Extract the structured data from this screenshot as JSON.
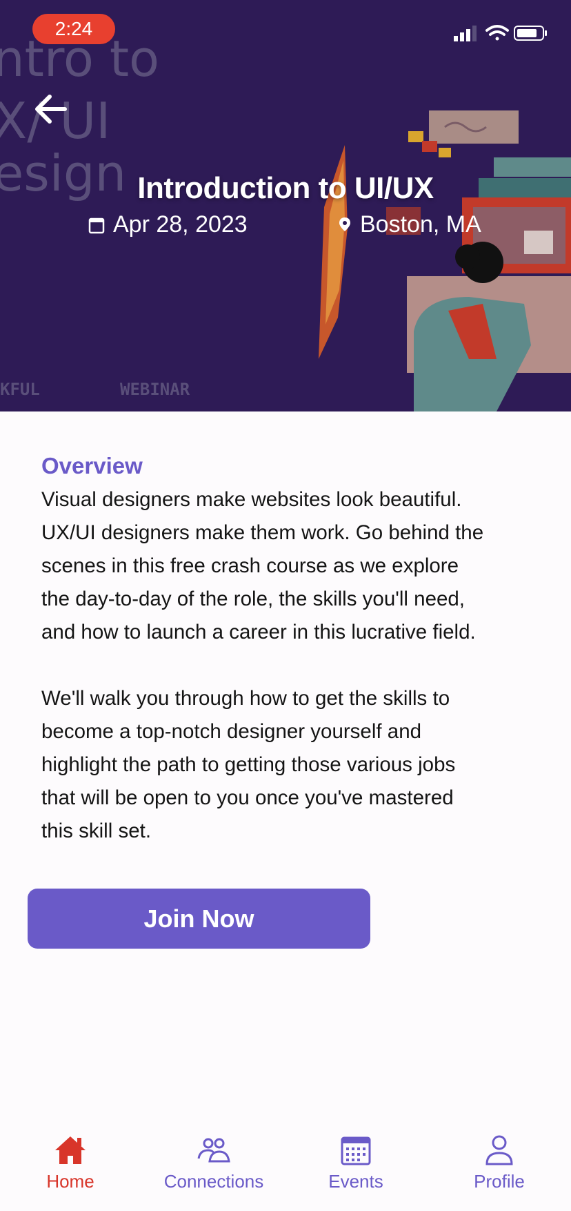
{
  "status_bar": {
    "time": "2:24"
  },
  "event": {
    "title": "Introduction to UI/UX",
    "date": "Apr 28, 2023",
    "location": "Boston, MA",
    "banner_text": {
      "line1": "ntro to",
      "line2": "X/ UI",
      "line3": "esign",
      "tag_left": "KFUL",
      "tag_right": "WEBINAR"
    }
  },
  "overview": {
    "heading": "Overview",
    "paragraph1": "Visual designers make websites look beautiful.\nUX/UI designers make them work. Go behind the\nscenes in this free crash course as we explore\nthe day-to-day of the role, the skills you'll need,\nand how to launch a career in this lucrative field.",
    "paragraph2": "We'll walk you through how to get the skills to\nbecome a top-notch designer yourself and\nhighlight the path to getting those various jobs\nthat will be open to you once you've mastered\nthis skill set."
  },
  "actions": {
    "join_label": "Join Now"
  },
  "tabs": [
    {
      "label": "Home",
      "icon": "home-icon",
      "active": true
    },
    {
      "label": "Connections",
      "icon": "connections-icon",
      "active": false
    },
    {
      "label": "Events",
      "icon": "calendar-icon",
      "active": false
    },
    {
      "label": "Profile",
      "icon": "profile-icon",
      "active": false
    }
  ],
  "colors": {
    "accent": "#6a5ac8",
    "active_tab": "#d8352a",
    "hero_bg": "#2e1b56",
    "time_pill": "#e8402f"
  }
}
